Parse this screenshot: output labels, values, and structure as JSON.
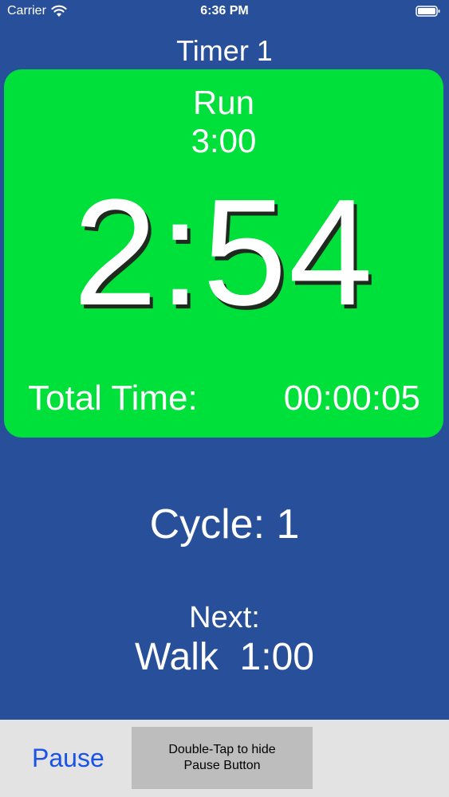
{
  "status_bar": {
    "carrier": "Carrier",
    "time": "6:36 PM",
    "icons": [
      "wifi-icon",
      "battery-icon"
    ]
  },
  "timer": {
    "title": "Timer 1",
    "current_interval": {
      "name": "Run",
      "duration": "3:00"
    },
    "countdown": "2:54",
    "total_time_label": "Total Time:",
    "total_time_value": "00:00:05",
    "panel_color": "#00e03a"
  },
  "cycle": "Cycle: 1",
  "next": {
    "label": "Next:",
    "interval": "Walk  1:00"
  },
  "controls": {
    "pause_label": "Pause",
    "hint_line1": "Double-Tap to hide",
    "hint_line2": "Pause Button"
  },
  "colors": {
    "background": "#284f9a",
    "accent": "#1a52e8"
  }
}
